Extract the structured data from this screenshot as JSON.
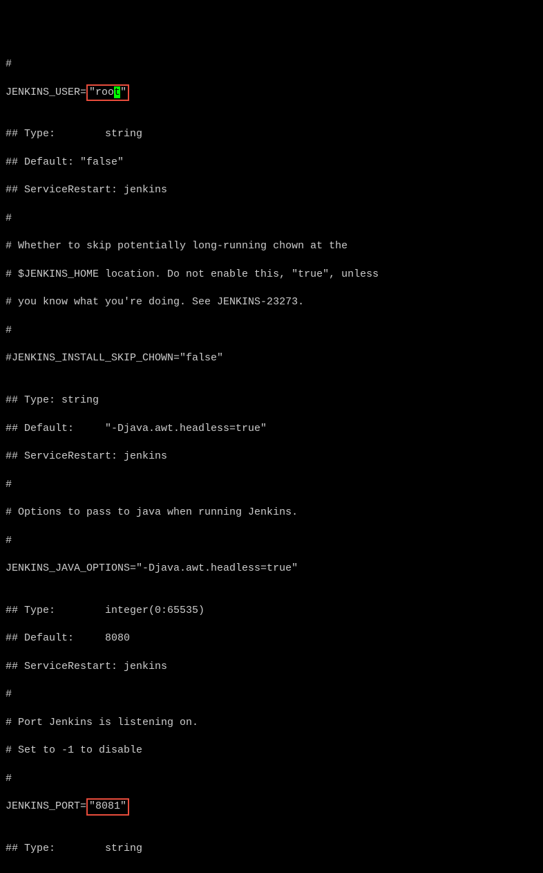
{
  "lines": {
    "l01": "#",
    "l02a": "JENKINS_USER=",
    "l02b": "\"roo",
    "l02c": "t",
    "l02d": "\"",
    "l03": "",
    "l04": "## Type:        string",
    "l05": "## Default: \"false\"",
    "l06": "## ServiceRestart: jenkins",
    "l07": "#",
    "l08": "# Whether to skip potentially long-running chown at the",
    "l09": "# $JENKINS_HOME location. Do not enable this, \"true\", unless",
    "l10": "# you know what you're doing. See JENKINS-23273.",
    "l11": "#",
    "l12": "#JENKINS_INSTALL_SKIP_CHOWN=\"false\"",
    "l13": "",
    "l14": "## Type: string",
    "l15": "## Default:     \"-Djava.awt.headless=true\"",
    "l16": "## ServiceRestart: jenkins",
    "l17": "#",
    "l18": "# Options to pass to java when running Jenkins.",
    "l19": "#",
    "l20": "JENKINS_JAVA_OPTIONS=\"-Djava.awt.headless=true\"",
    "l21": "",
    "l22": "## Type:        integer(0:65535)",
    "l23": "## Default:     8080",
    "l24": "## ServiceRestart: jenkins",
    "l25": "#",
    "l26": "# Port Jenkins is listening on.",
    "l27": "# Set to -1 to disable",
    "l28": "#",
    "l29a": "JENKINS_PORT=",
    "l29b": "\"8081\"",
    "l30": "",
    "l31": "## Type:        string"
  }
}
